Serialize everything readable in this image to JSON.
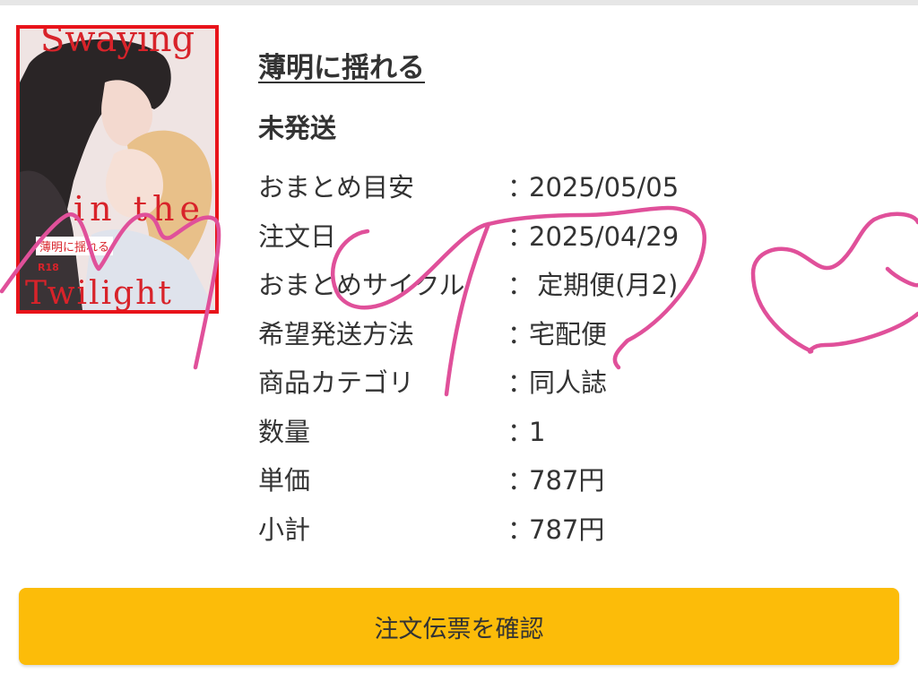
{
  "product": {
    "title": "薄明に揺れる",
    "status": "未発送"
  },
  "cover": {
    "title_lines": [
      "Swaying",
      "in the",
      "Twilight"
    ],
    "jp_title": "薄明に揺れる",
    "rating": "R18",
    "border_color": "#e8131a"
  },
  "details": [
    {
      "label": "おまとめ目安",
      "value": "2025/05/05"
    },
    {
      "label": "注文日",
      "value": "2025/04/29"
    },
    {
      "label": "おまとめサイクル",
      "value": " 定期便(月2)"
    },
    {
      "label": "希望発送方法",
      "value": "宅配便"
    },
    {
      "label": "商品カテゴリ",
      "value": "同人誌"
    },
    {
      "label": "数量",
      "value": "1"
    },
    {
      "label": "単価",
      "value": "787円"
    },
    {
      "label": "小計",
      "value": "787円"
    }
  ],
  "separator": "：",
  "actions": {
    "confirm_label": "注文伝票を確認"
  },
  "colors": {
    "button": "#fcbc09",
    "scribble": "#e0509a",
    "text": "#333333"
  }
}
